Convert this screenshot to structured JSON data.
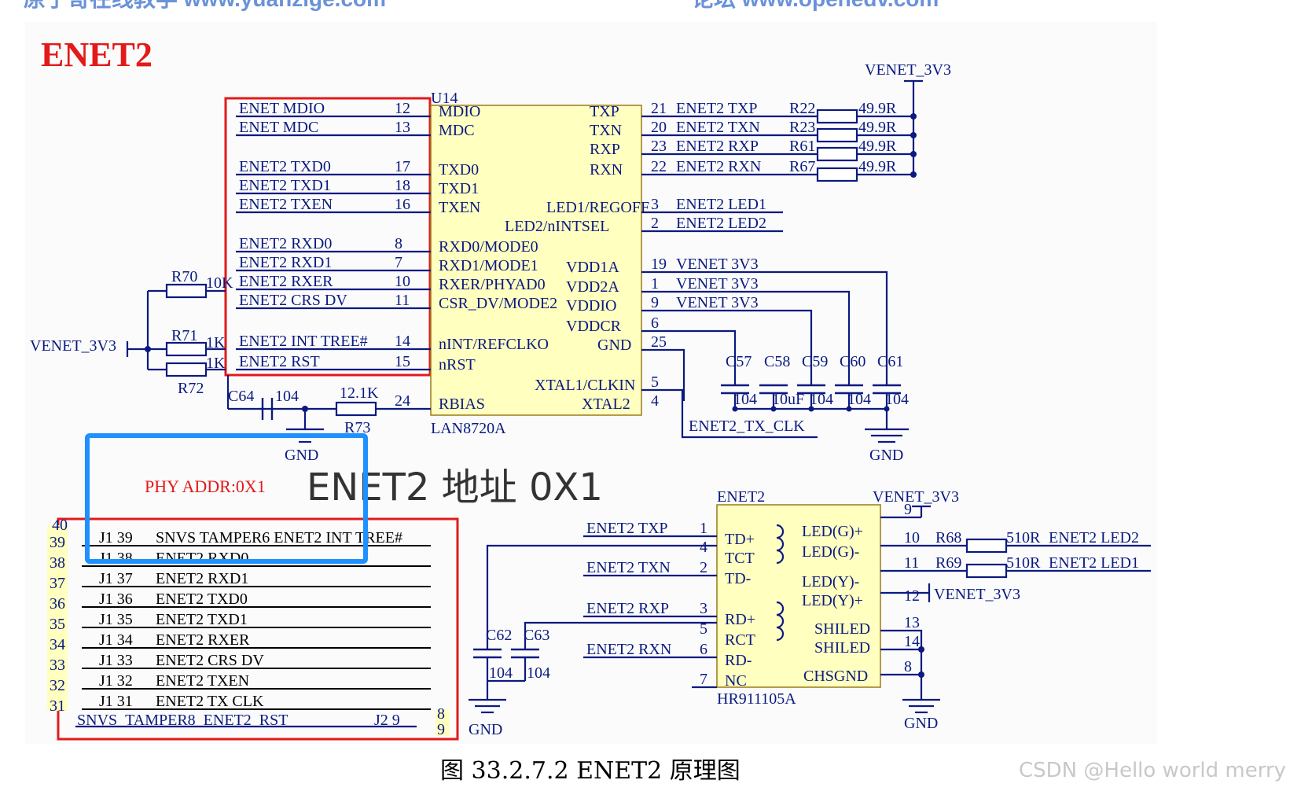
{
  "header_faded": {
    "left": "原子哥在线教学 www.yuanzige.com",
    "right": "论坛 www.openedv.com"
  },
  "diagram_title": "ENET2",
  "chip": {
    "ref": "U14",
    "part": "LAN8720A",
    "left_pins": [
      {
        "name": "MDIO",
        "num": "12",
        "net": "ENET_MDIO"
      },
      {
        "name": "MDC",
        "num": "13",
        "net": "ENET_MDC"
      },
      {
        "name": "TXD0",
        "num": "17",
        "net": "ENET2_TXD0"
      },
      {
        "name": "TXD1",
        "num": "18",
        "net": "ENET2_TXD1"
      },
      {
        "name": "TXEN",
        "num": "16",
        "net": "ENET2_TXEN"
      },
      {
        "name": "RXD0/MODE0",
        "num": "8",
        "net": "ENET2_RXD0"
      },
      {
        "name": "RXD1/MODE1",
        "num": "7",
        "net": "ENET2_RXD1"
      },
      {
        "name": "RXER/PHYAD0",
        "num": "10",
        "net": "ENET2_RXER"
      },
      {
        "name": "CSR_DV/MODE2",
        "num": "11",
        "net": "ENET2_CRS_DV"
      },
      {
        "name": "nINT/REFCLKO",
        "num": "14",
        "net": "ENET2_INT_TREE#"
      },
      {
        "name": "nRST",
        "num": "15",
        "net": "ENET2_RST"
      },
      {
        "name": "RBIAS",
        "num": "24",
        "net": ""
      }
    ],
    "right_pins": [
      {
        "name": "TXP",
        "num": "21",
        "net": "ENET2_TXP",
        "res": "R22",
        "val": "49.9R"
      },
      {
        "name": "TXN",
        "num": "20",
        "net": "ENET2_TXN",
        "res": "R23",
        "val": "49.9R"
      },
      {
        "name": "RXP",
        "num": "23",
        "net": "ENET2_RXP",
        "res": "R61",
        "val": "49.9R"
      },
      {
        "name": "RXN",
        "num": "22",
        "net": "ENET2_RXN",
        "res": "R67",
        "val": "49.9R"
      },
      {
        "name": "LED1/REGOFF",
        "num": "3",
        "net": "ENET2_LED1"
      },
      {
        "name": "LED2/nINTSEL",
        "num": "2",
        "net": "ENET2_LED2"
      },
      {
        "name": "VDD1A",
        "num": "19",
        "net": "VENET_3V3"
      },
      {
        "name": "VDD2A",
        "num": "1",
        "net": "VENET_3V3"
      },
      {
        "name": "VDDIO",
        "num": "9",
        "net": "VENET_3V3"
      },
      {
        "name": "VDDCR",
        "num": "6",
        "net": ""
      },
      {
        "name": "GND",
        "num": "25",
        "net": ""
      },
      {
        "name": "XTAL1/CLKIN",
        "num": "5",
        "net": "ENET2_TX_CLK"
      },
      {
        "name": "XTAL2",
        "num": "4",
        "net": ""
      }
    ]
  },
  "labels": {
    "venet": "VENET_3V3",
    "gnd": "GND",
    "r70": "R70",
    "r70v": "10K",
    "r71": "R71",
    "r71v": "1K",
    "r72": "R72",
    "r72v": "1K",
    "c64": "C64",
    "c64v": "104",
    "r73": "R73",
    "r73v": "12.1K",
    "caps": [
      {
        "ref": "C57",
        "val": "104"
      },
      {
        "ref": "C58",
        "val": "10uF"
      },
      {
        "ref": "C59",
        "val": "104"
      },
      {
        "ref": "C60",
        "val": "104"
      },
      {
        "ref": "C61",
        "val": "104"
      }
    ],
    "phy_addr": "PHY ADDR:0X1",
    "annotation": "ENET2 地址 0X1"
  },
  "connector": {
    "rows": [
      {
        "pin": "J1  39",
        "net": "SNVS_TAMPER6_ENET2_INT_TREE#",
        "side": "39"
      },
      {
        "pin": "J1  38",
        "net": "ENET2_RXD0",
        "side": "38"
      },
      {
        "pin": "J1  37",
        "net": "ENET2_RXD1",
        "side": "37"
      },
      {
        "pin": "J1  36",
        "net": "ENET2_TXD0",
        "side": "36"
      },
      {
        "pin": "J1  35",
        "net": "ENET2_TXD1",
        "side": "35"
      },
      {
        "pin": "J1  34",
        "net": "ENET2_RXER",
        "side": "34"
      },
      {
        "pin": "J1  33",
        "net": "ENET2_CRS_DV",
        "side": "33"
      },
      {
        "pin": "J1  32",
        "net": "ENET2_TXEN",
        "side": "32"
      },
      {
        "pin": "J1  31",
        "net": "ENET2_TX_CLK",
        "side": "31"
      }
    ],
    "bottom_net": "SNVS_TAMPER8_ENET2_RST",
    "bottom_pin": "J2  9",
    "bottom_side_a": "8",
    "bottom_side_b": "9",
    "top_side": "40"
  },
  "magjack": {
    "ref": "ENET2",
    "part": "HR911105A",
    "left_pins": [
      {
        "name": "TD+",
        "num": "1",
        "net": "ENET2_TXP"
      },
      {
        "name": "TCT",
        "num": "4",
        "net": ""
      },
      {
        "name": "TD-",
        "num": "2",
        "net": "ENET2_TXN"
      },
      {
        "name": "RD+",
        "num": "3",
        "net": "ENET2_RXP"
      },
      {
        "name": "RCT",
        "num": "5",
        "net": ""
      },
      {
        "name": "RD-",
        "num": "6",
        "net": "ENET2_RXN"
      },
      {
        "name": "NC",
        "num": "7",
        "net": ""
      }
    ],
    "right_pins": [
      {
        "name": "LED(G)+",
        "num": "9",
        "net": "VENET_3V3"
      },
      {
        "name": "LED(G)-",
        "num": "10",
        "net": "ENET2_LED2",
        "res": "R68",
        "val": "510R"
      },
      {
        "name": "LED(Y)-",
        "num": "11",
        "net": "ENET2_LED1",
        "res": "R69",
        "val": "510R"
      },
      {
        "name": "LED(Y)+",
        "num": "12",
        "net": "VENET_3V3"
      },
      {
        "name": "SHILED",
        "num": "13",
        "net": ""
      },
      {
        "name": "SHILED",
        "num": "14",
        "net": ""
      },
      {
        "name": "CHSGND",
        "num": "8",
        "net": ""
      }
    ],
    "caps": [
      {
        "ref": "C62",
        "val": "104"
      },
      {
        "ref": "C63",
        "val": "104"
      }
    ]
  },
  "caption": "图 33.2.7.2 ENET2 原理图",
  "watermark": "CSDN @Hello world merry",
  "colors": {
    "wire": "#0a1a80",
    "box": "#e21a1a",
    "chip": "#ffffc0",
    "highlight": "#1e90ff"
  }
}
